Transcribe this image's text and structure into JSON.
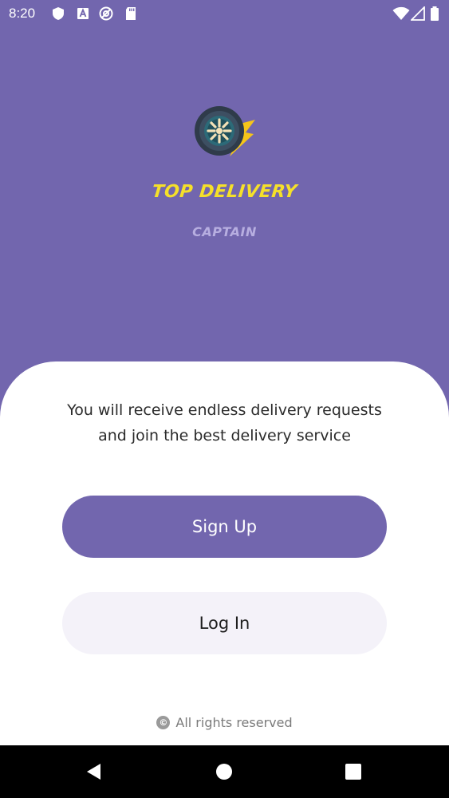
{
  "status_bar": {
    "time": "8:20",
    "left_icons": [
      "shield-icon",
      "a-badge-icon",
      "at-sign-icon",
      "sd-card-icon"
    ],
    "right_icons": [
      "wifi-icon",
      "signal-icon",
      "battery-icon"
    ]
  },
  "brand": {
    "title": "TOP DELIVERY",
    "subtitle": "CAPTAIN",
    "logo_icon": "wheel-bolt-logo-icon",
    "title_color": "#f5e02a",
    "subtitle_color": "#b7aee0"
  },
  "sheet": {
    "tagline_line1": "You will receive endless delivery requests",
    "tagline_line2": "and join the best delivery service",
    "signup_label": "Sign Up",
    "login_label": "Log In",
    "footer_text": "All rights reserved",
    "footer_icon": "copyright-icon"
  },
  "nav_bar": {
    "buttons": [
      "back-icon",
      "home-icon",
      "recents-icon"
    ]
  },
  "colors": {
    "primary": "#7266ae",
    "secondary_button": "#f4f2f9",
    "background": "#ffffff"
  }
}
